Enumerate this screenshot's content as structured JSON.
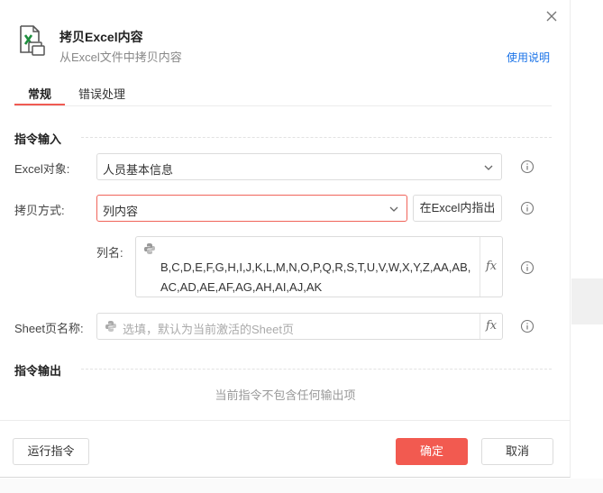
{
  "dialog": {
    "title": "拷贝Excel内容",
    "subtitle": "从Excel文件中拷贝内容",
    "help_link": "使用说明"
  },
  "tabs": [
    {
      "label": "常规",
      "active": true
    },
    {
      "label": "错误处理",
      "active": false
    }
  ],
  "input_section": {
    "title": "指令输入",
    "excel_object": {
      "label": "Excel对象:",
      "value": "人员基本信息"
    },
    "copy_mode": {
      "label": "拷贝方式:",
      "value": "列内容",
      "locate_button": "在Excel内指出"
    },
    "column_names": {
      "label": "列名:",
      "value": "B,C,D,E,F,G,H,I,J,K,L,M,N,O,P,Q,R,S,T,U,V,W,X,Y,Z,AA,AB,AC,AD,AE,AF,AG,AH,AI,AJ,AK"
    },
    "sheet_name": {
      "label": "Sheet页名称:",
      "placeholder": "选填，默认为当前激活的Sheet页"
    },
    "fx_label": "fx"
  },
  "output_section": {
    "title": "指令输出",
    "empty_text": "当前指令不包含任何输出项"
  },
  "footer": {
    "run_button": "运行指令",
    "confirm_button": "确定",
    "cancel_button": "取消"
  },
  "colors": {
    "accent": "#f25a50",
    "link": "#1a73e8",
    "excel_green": "#1e8e3e"
  }
}
